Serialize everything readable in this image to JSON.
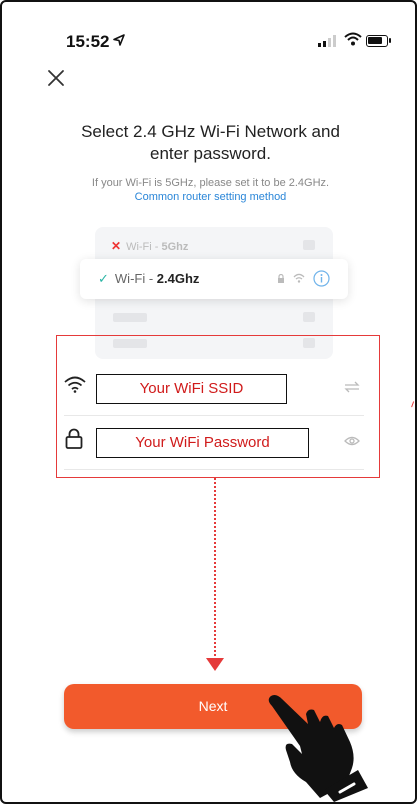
{
  "status_bar": {
    "time": "15:52"
  },
  "header": {
    "close_icon": "close-icon"
  },
  "page": {
    "title_line1": "Select 2.4 GHz Wi-Fi Network and",
    "title_line2": "enter password.",
    "hint": "If your Wi-Fi is 5GHz, please set it to be 2.4GHz.",
    "hint_link": "Common router setting method"
  },
  "illustration": {
    "row_5ghz_prefix": "Wi-Fi - ",
    "row_5ghz_band": "5Ghz",
    "row_24ghz_prefix": "Wi-Fi - ",
    "row_24ghz_band": "2.4Ghz"
  },
  "form": {
    "ssid_value": "Your WiFi SSID",
    "password_value": "Your WiFi Password"
  },
  "footer": {
    "next_label": "Next"
  },
  "colors": {
    "accent": "#f25a2c",
    "annotation": "#e53a3a",
    "link": "#2a86d8",
    "check": "#2ab5a5"
  }
}
